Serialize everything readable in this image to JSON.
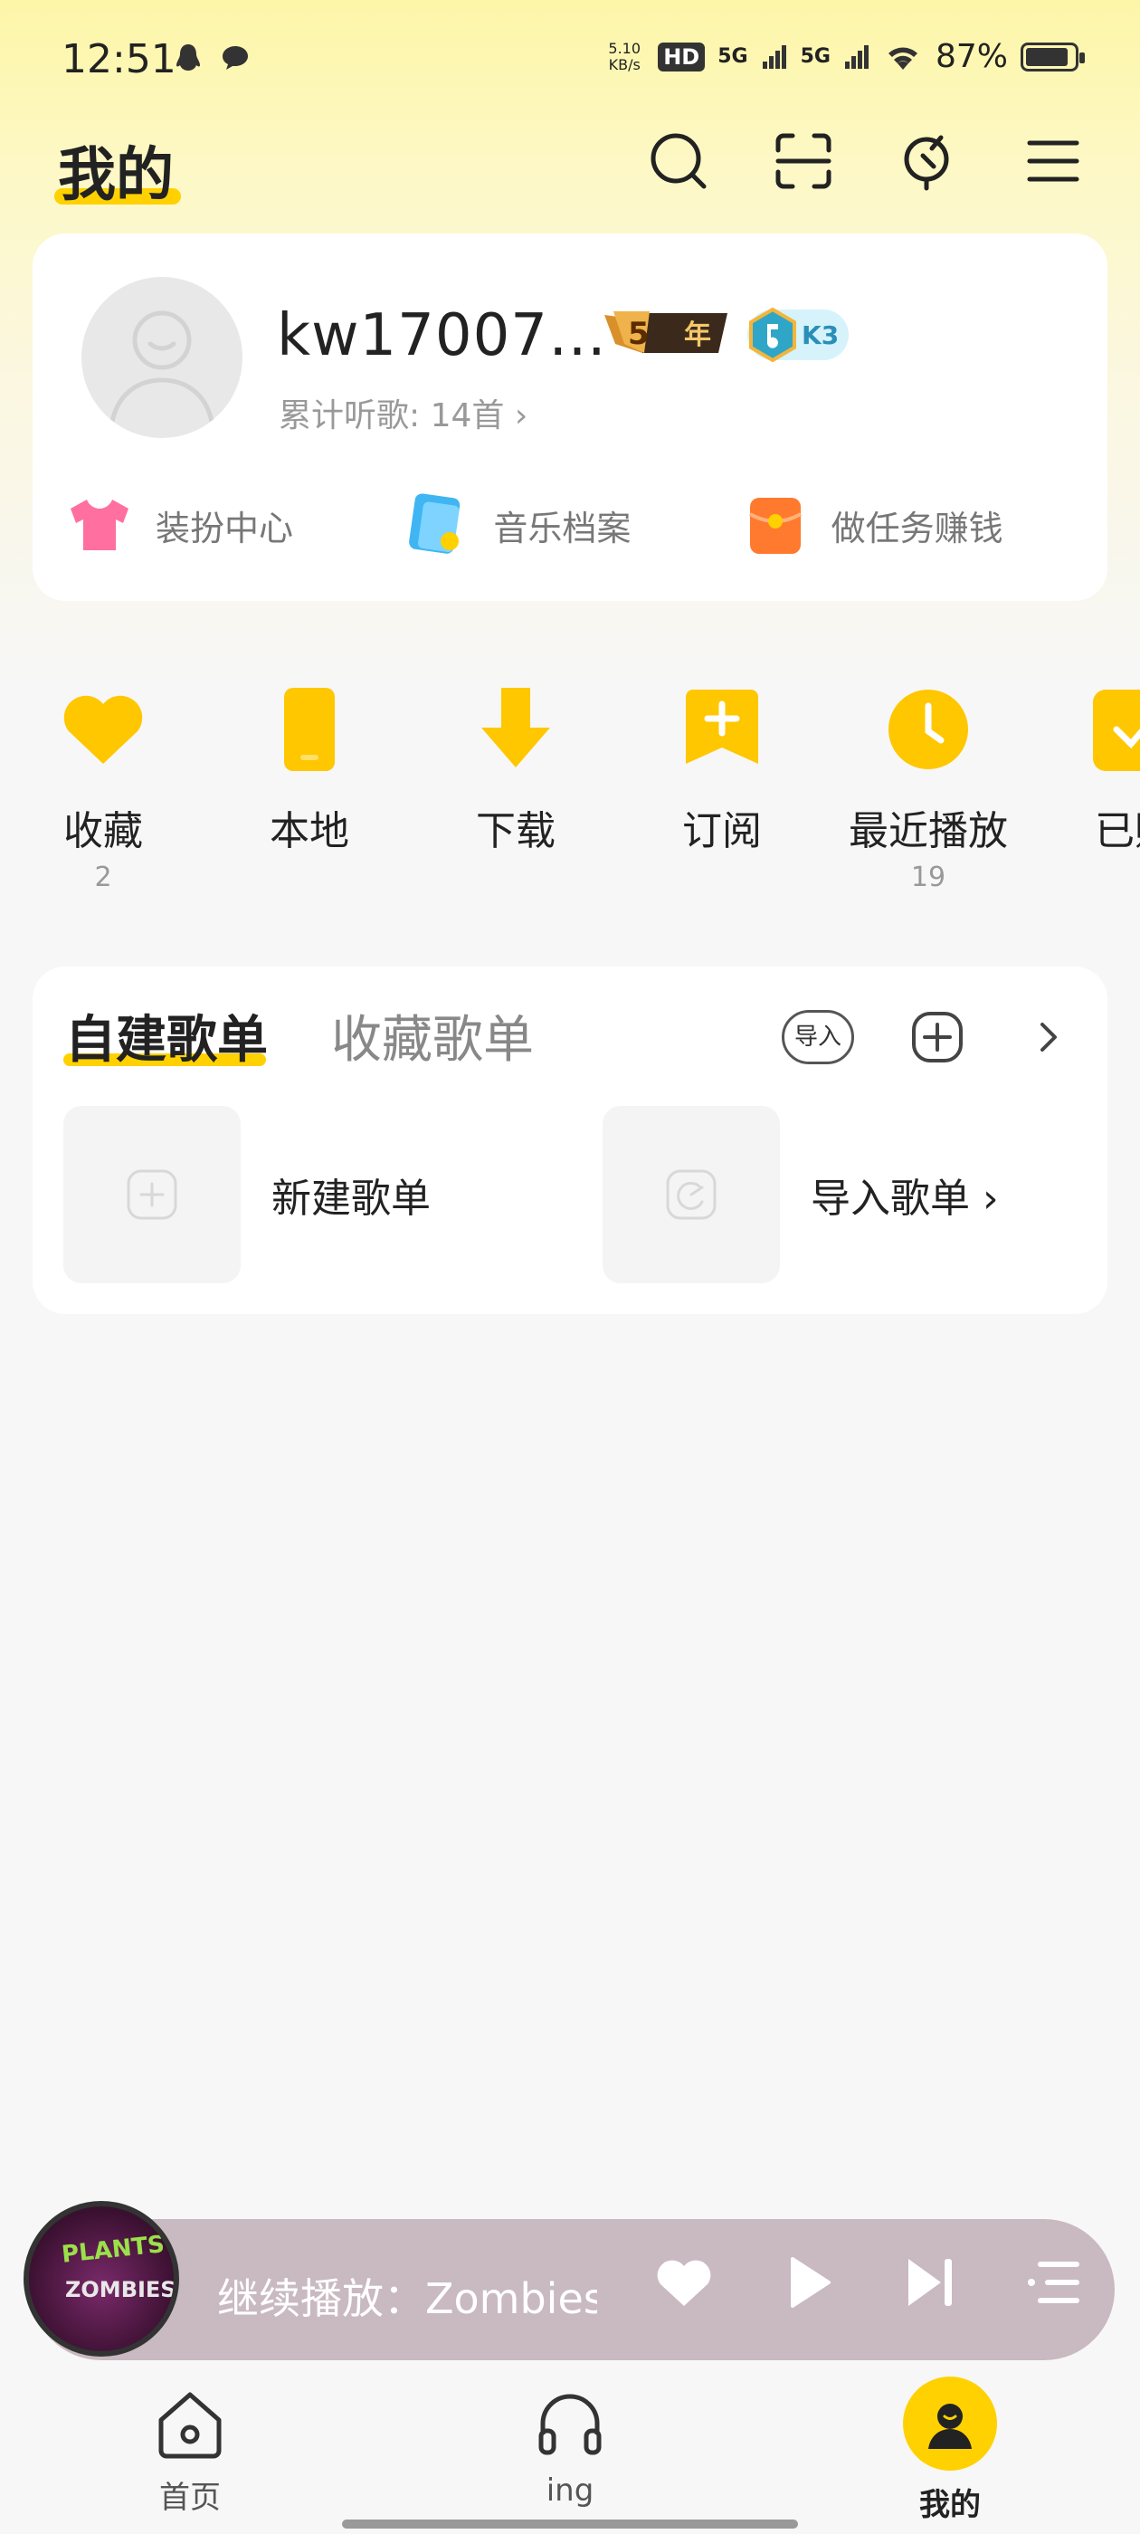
{
  "status_bar": {
    "time": "12:51",
    "net_speed": "5.10\nKB/s",
    "hd": "HD",
    "signal1": "5G",
    "signal2": "5G",
    "battery": "87%"
  },
  "header": {
    "title": "我的",
    "icons": [
      "search-icon",
      "scan-icon",
      "microphone-icon",
      "menu-icon"
    ]
  },
  "profile": {
    "username": "kw17007…",
    "vip_years": "5",
    "vip_label": "年",
    "level": "K3",
    "listen_count": "累计听歌: 14首 ›",
    "links": [
      {
        "label": "装扮中心",
        "icon": "tshirt-icon"
      },
      {
        "label": "音乐档案",
        "icon": "music-archive-icon"
      },
      {
        "label": "做任务赚钱",
        "icon": "red-envelope-icon"
      }
    ]
  },
  "quick_access": [
    {
      "label": "收藏",
      "count": "2",
      "icon": "heart-icon"
    },
    {
      "label": "本地",
      "count": "",
      "icon": "phone-icon"
    },
    {
      "label": "下载",
      "count": "",
      "icon": "download-icon"
    },
    {
      "label": "订阅",
      "count": "",
      "icon": "subscribe-icon"
    },
    {
      "label": "最近播放",
      "count": "19",
      "icon": "clock-icon"
    },
    {
      "label": "已购",
      "count": "",
      "icon": "purchased-icon"
    }
  ],
  "playlists": {
    "tab_created": "自建歌单",
    "tab_collected": "收藏歌单",
    "import_label": "导入",
    "new_playlist": "新建歌单",
    "import_playlist": "导入歌单 ›"
  },
  "mini_player": {
    "title": "继续播放：Zombies",
    "cover_line1": "PLANTS",
    "cover_line2": "ZOMBIES"
  },
  "bottom_nav": [
    {
      "label": "首页",
      "icon": "home-icon"
    },
    {
      "label": "ing",
      "icon": "headphones-icon"
    },
    {
      "label": "我的",
      "icon": "profile-icon"
    }
  ],
  "colors": {
    "accent": "#ffd100",
    "mini_player_bg": "#c9b9c0"
  }
}
